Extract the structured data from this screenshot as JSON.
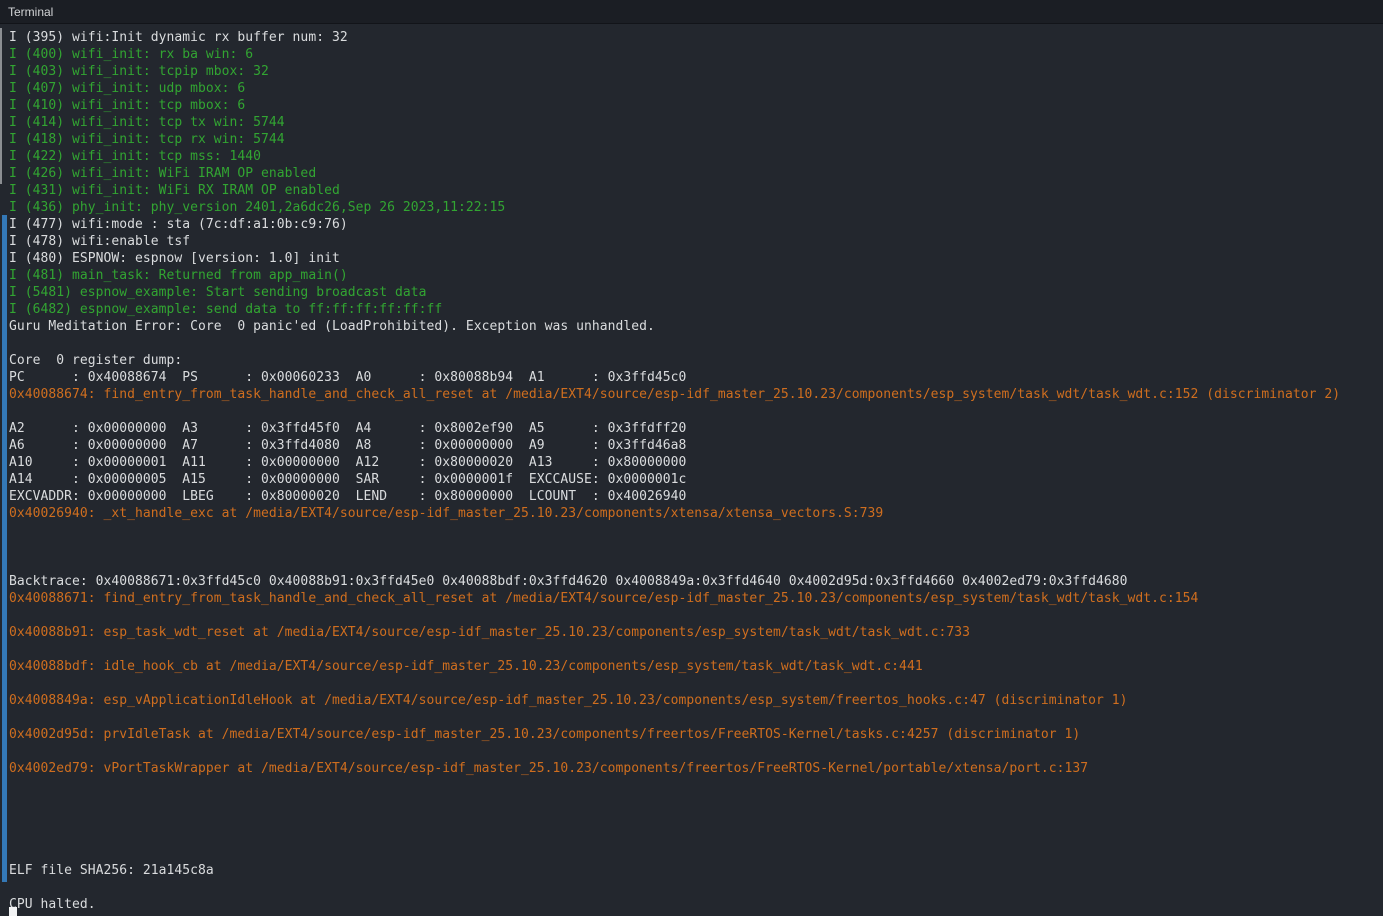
{
  "titlebar": {
    "title": "Terminal"
  },
  "colors": {
    "background": "#23272e",
    "titlebar_background": "#1b1e24",
    "text": "#dadcde",
    "green": "#32a532",
    "orange": "#cf6e1f",
    "indicator_blue": "#3478b6"
  },
  "terminal": {
    "lines": [
      {
        "text": "I (395) wifi:Init dynamic rx buffer num: 32",
        "color": "default"
      },
      {
        "text": "I (400) wifi_init: rx ba win: 6",
        "color": "green"
      },
      {
        "text": "I (403) wifi_init: tcpip mbox: 32",
        "color": "green"
      },
      {
        "text": "I (407) wifi_init: udp mbox: 6",
        "color": "green"
      },
      {
        "text": "I (410) wifi_init: tcp mbox: 6",
        "color": "green"
      },
      {
        "text": "I (414) wifi_init: tcp tx win: 5744",
        "color": "green"
      },
      {
        "text": "I (418) wifi_init: tcp rx win: 5744",
        "color": "green"
      },
      {
        "text": "I (422) wifi_init: tcp mss: 1440",
        "color": "green"
      },
      {
        "text": "I (426) wifi_init: WiFi IRAM OP enabled",
        "color": "green"
      },
      {
        "text": "I (431) wifi_init: WiFi RX IRAM OP enabled",
        "color": "green"
      },
      {
        "text": "I (436) phy_init: phy_version 2401,2a6dc26,Sep 26 2023,11:22:15",
        "color": "green"
      },
      {
        "text": "I (477) wifi:mode : sta (7c:df:a1:0b:c9:76)",
        "color": "default"
      },
      {
        "text": "I (478) wifi:enable tsf",
        "color": "default"
      },
      {
        "text": "I (480) ESPNOW: espnow [version: 1.0] init",
        "color": "default"
      },
      {
        "text": "I (481) main_task: Returned from app_main()",
        "color": "green"
      },
      {
        "text": "I (5481) espnow_example: Start sending broadcast data",
        "color": "green"
      },
      {
        "text": "I (6482) espnow_example: send data to ff:ff:ff:ff:ff:ff",
        "color": "green"
      },
      {
        "text": "Guru Meditation Error: Core  0 panic'ed (LoadProhibited). Exception was unhandled.",
        "color": "default"
      },
      {
        "text": "",
        "color": "default"
      },
      {
        "text": "Core  0 register dump:",
        "color": "default"
      },
      {
        "text": "PC      : 0x40088674  PS      : 0x00060233  A0      : 0x80088b94  A1      : 0x3ffd45c0",
        "color": "default"
      },
      {
        "text": "0x40088674: find_entry_from_task_handle_and_check_all_reset at /media/EXT4/source/esp-idf_master_25.10.23/components/esp_system/task_wdt/task_wdt.c:152 (discriminator 2)",
        "color": "orange"
      },
      {
        "text": "",
        "color": "default"
      },
      {
        "text": "A2      : 0x00000000  A3      : 0x3ffd45f0  A4      : 0x8002ef90  A5      : 0x3ffdff20",
        "color": "default"
      },
      {
        "text": "A6      : 0x00000000  A7      : 0x3ffd4080  A8      : 0x00000000  A9      : 0x3ffd46a8",
        "color": "default"
      },
      {
        "text": "A10     : 0x00000001  A11     : 0x00000000  A12     : 0x80000020  A13     : 0x80000000",
        "color": "default"
      },
      {
        "text": "A14     : 0x00000005  A15     : 0x00000000  SAR     : 0x0000001f  EXCCAUSE: 0x0000001c",
        "color": "default"
      },
      {
        "text": "EXCVADDR: 0x00000000  LBEG    : 0x80000020  LEND    : 0x80000000  LCOUNT  : 0x40026940",
        "color": "default"
      },
      {
        "text": "0x40026940: _xt_handle_exc at /media/EXT4/source/esp-idf_master_25.10.23/components/xtensa/xtensa_vectors.S:739",
        "color": "orange"
      },
      {
        "text": "",
        "color": "default"
      },
      {
        "text": "",
        "color": "default"
      },
      {
        "text": "",
        "color": "default"
      },
      {
        "text": "Backtrace: 0x40088671:0x3ffd45c0 0x40088b91:0x3ffd45e0 0x40088bdf:0x3ffd4620 0x4008849a:0x3ffd4640 0x4002d95d:0x3ffd4660 0x4002ed79:0x3ffd4680",
        "color": "default"
      },
      {
        "text": "0x40088671: find_entry_from_task_handle_and_check_all_reset at /media/EXT4/source/esp-idf_master_25.10.23/components/esp_system/task_wdt/task_wdt.c:154",
        "color": "orange"
      },
      {
        "text": "",
        "color": "default"
      },
      {
        "text": "0x40088b91: esp_task_wdt_reset at /media/EXT4/source/esp-idf_master_25.10.23/components/esp_system/task_wdt/task_wdt.c:733",
        "color": "orange"
      },
      {
        "text": "",
        "color": "default"
      },
      {
        "text": "0x40088bdf: idle_hook_cb at /media/EXT4/source/esp-idf_master_25.10.23/components/esp_system/task_wdt/task_wdt.c:441",
        "color": "orange"
      },
      {
        "text": "",
        "color": "default"
      },
      {
        "text": "0x4008849a: esp_vApplicationIdleHook at /media/EXT4/source/esp-idf_master_25.10.23/components/esp_system/freertos_hooks.c:47 (discriminator 1)",
        "color": "orange"
      },
      {
        "text": "",
        "color": "default"
      },
      {
        "text": "0x4002d95d: prvIdleTask at /media/EXT4/source/esp-idf_master_25.10.23/components/freertos/FreeRTOS-Kernel/tasks.c:4257 (discriminator 1)",
        "color": "orange"
      },
      {
        "text": "",
        "color": "default"
      },
      {
        "text": "0x4002ed79: vPortTaskWrapper at /media/EXT4/source/esp-idf_master_25.10.23/components/freertos/FreeRTOS-Kernel/portable/xtensa/port.c:137",
        "color": "orange"
      },
      {
        "text": "",
        "color": "default"
      },
      {
        "text": "",
        "color": "default"
      },
      {
        "text": "",
        "color": "default"
      },
      {
        "text": "",
        "color": "default"
      },
      {
        "text": "",
        "color": "default"
      },
      {
        "text": "ELF file SHA256: 21a145c8a",
        "color": "default"
      },
      {
        "text": "",
        "color": "default"
      },
      {
        "text": "CPU halted.",
        "color": "default"
      }
    ]
  }
}
